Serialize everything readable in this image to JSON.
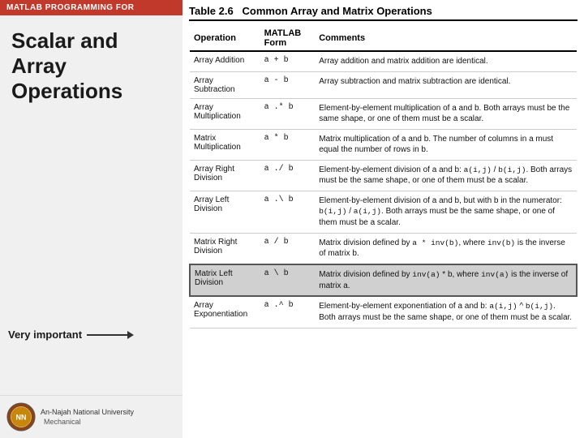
{
  "sidebar": {
    "header": "MATLAB PROGRAMMING FOR",
    "title": "Scalar and Array Operations",
    "very_important": "Very important",
    "university_name": "An-Najah National University",
    "mechanical": "Mechanical"
  },
  "table": {
    "title_num": "Table 2.6",
    "title_text": "Common Array and Matrix Operations",
    "headers": [
      "Operation",
      "MATLAB Form",
      "Comments"
    ],
    "rows": [
      {
        "operation": "Array Addition",
        "matlab_form": "a + b",
        "comments": "Array addition and matrix addition are identical.",
        "highlighted": false
      },
      {
        "operation": "Array Subtraction",
        "matlab_form": "a - b",
        "comments": "Array subtraction and matrix subtraction are identical.",
        "highlighted": false
      },
      {
        "operation": "Array Multiplication",
        "matlab_form": "a .* b",
        "comments": "Element-by-element multiplication of a and b. Both arrays must be the same shape, or one of them must be a scalar.",
        "highlighted": false
      },
      {
        "operation": "Matrix Multiplication",
        "matlab_form": "a * b",
        "comments": "Matrix multiplication of a and b. The number of columns in a must equal the number of rows in b.",
        "highlighted": false
      },
      {
        "operation": "Array Right Division",
        "matlab_form": "a ./ b",
        "comments": "Element-by-element division of a and b: a(i,j) / b(i,j). Both arrays must be the same shape, or one of them must be a scalar.",
        "highlighted": false
      },
      {
        "operation": "Array Left Division",
        "matlab_form": "a .\\ b",
        "comments": "Element-by-element division of a and b, but with b in the numerator: b(i,j) / a(i,j). Both arrays must be the same shape, or one of them must be a scalar.",
        "highlighted": false
      },
      {
        "operation": "Matrix Right Division",
        "matlab_form": "a / b",
        "comments": "Matrix division defined by a * inv(b), where inv(b) is the inverse of matrix b.",
        "highlighted": false
      },
      {
        "operation": "Matrix Left Division",
        "matlab_form": "a \\ b",
        "comments": "Matrix division defined by inv(a) * b, where inv(a) is the inverse of matrix a.",
        "highlighted": true
      },
      {
        "operation": "Array Exponentiation",
        "matlab_form": "a .^ b",
        "comments": "Element-by-element exponentiation of a and b: a(i,j) ^ b(i,j). Both arrays must be the same shape, or one of them must be a scalar.",
        "highlighted": false
      }
    ]
  }
}
